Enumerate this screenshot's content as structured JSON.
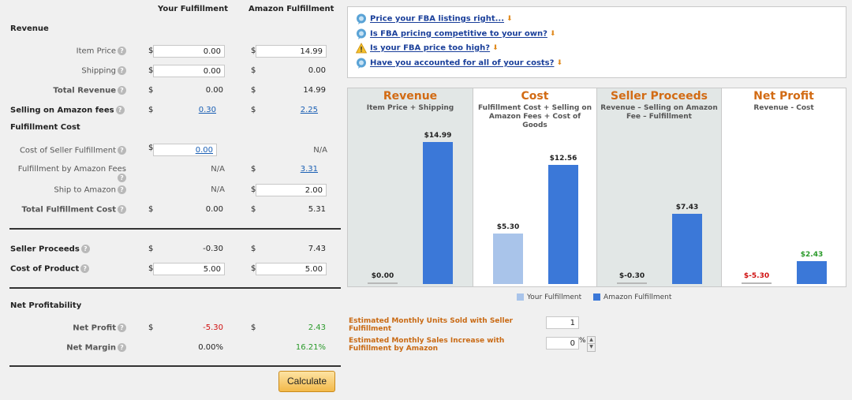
{
  "headers": {
    "your": "Your Fulfillment",
    "amazon": "Amazon Fulfillment"
  },
  "currency": "$",
  "help_icon": "?",
  "revenue": {
    "section": "Revenue",
    "item_price": {
      "label": "Item Price",
      "your": "0.00",
      "amazon": "14.99"
    },
    "shipping": {
      "label": "Shipping",
      "your": "0.00",
      "amazon": "0.00"
    },
    "total": {
      "label": "Total Revenue",
      "your": "0.00",
      "amazon": "14.99"
    }
  },
  "selling_fees": {
    "label": "Selling on Amazon fees",
    "your": "0.30",
    "amazon": "2.25"
  },
  "fulfillment": {
    "section": "Fulfillment Cost",
    "seller": {
      "label": "Cost of Seller Fulfillment",
      "your": "0.00",
      "amazon": "N/A"
    },
    "fba": {
      "label": "Fulfillment by Amazon Fees",
      "your": "N/A",
      "amazon": "3.31"
    },
    "ship": {
      "label": "Ship to Amazon",
      "your": "N/A",
      "amazon": "2.00"
    },
    "total": {
      "label": "Total Fulfillment Cost",
      "your": "0.00",
      "amazon": "5.31"
    }
  },
  "seller_proceeds": {
    "label": "Seller Proceeds",
    "your": "-0.30",
    "amazon": "7.43"
  },
  "cost_of_product": {
    "label": "Cost of Product",
    "your": "5.00",
    "amazon": "5.00"
  },
  "net": {
    "section": "Net Profitability",
    "profit": {
      "label": "Net Profit",
      "your": "-5.30",
      "amazon": "2.43"
    },
    "margin": {
      "label": "Net Margin",
      "your": "0.00%",
      "amazon": "16.21%"
    }
  },
  "calculate_label": "Calculate",
  "links": [
    {
      "text": "Price your FBA listings right...",
      "icon": "speech-bubble-icon"
    },
    {
      "text": "Is FBA pricing competitive to your own?",
      "icon": "speech-bubble-icon"
    },
    {
      "text": "Is your FBA price too high?",
      "icon": "warning-icon"
    },
    {
      "text": "Have you accounted for all of your costs?",
      "icon": "speech-bubble-icon"
    }
  ],
  "chart": {
    "columns": [
      {
        "title": "Revenue",
        "subtitle": "Item Price + Shipping",
        "your": "$0.00",
        "amazon": "$14.99",
        "your_value": 0,
        "amazon_value": 14.99
      },
      {
        "title": "Cost",
        "subtitle": "Fulfillment Cost + Selling on Amazon Fees + Cost of Goods",
        "your": "$5.30",
        "amazon": "$12.56",
        "your_value": 5.3,
        "amazon_value": 12.56
      },
      {
        "title": "Seller Proceeds",
        "subtitle": "Revenue – Selling on Amazon Fee – Fulfillment",
        "your": "$-0.30",
        "amazon": "$7.43",
        "your_value": -0.3,
        "amazon_value": 7.43
      },
      {
        "title": "Net Profit",
        "subtitle": "Revenue - Cost",
        "your": "$-5.30",
        "amazon": "$2.43",
        "your_value": -5.3,
        "amazon_value": 2.43
      }
    ],
    "legend": {
      "your": "Your Fulfillment",
      "amazon": "Amazon Fulfillment"
    },
    "colors": {
      "title": "#d26b14",
      "your": "#a9c4ea",
      "amazon": "#3b78d8"
    }
  },
  "estimates": {
    "units_label": "Estimated Monthly Units Sold with Seller Fulfillment",
    "units_value": "1",
    "increase_label": "Estimated Monthly Sales Increase with Fulfillment by Amazon",
    "increase_value": "0",
    "increase_unit": "%"
  }
}
